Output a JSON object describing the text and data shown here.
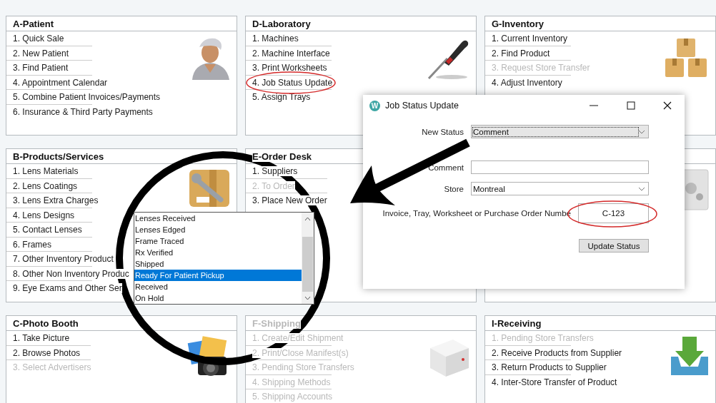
{
  "panels": [
    {
      "title": "A-Patient",
      "disabled": false,
      "items": [
        {
          "label": "1. Quick Sale",
          "disabled": false
        },
        {
          "label": "2. New Patient",
          "disabled": false
        },
        {
          "label": "3. Find Patient",
          "disabled": false
        },
        {
          "label": "4. Appointment Calendar",
          "disabled": false
        },
        {
          "label": "5. Combine Patient Invoices/Payments",
          "disabled": false
        },
        {
          "label": "6. Insurance & Third Party Payments",
          "disabled": false
        }
      ]
    },
    {
      "title": "D-Laboratory",
      "disabled": false,
      "items": [
        {
          "label": "1. Machines",
          "disabled": false
        },
        {
          "label": "2. Machine Interface",
          "disabled": false
        },
        {
          "label": "3. Print Worksheets",
          "disabled": false
        },
        {
          "label": "4. Job Status Update",
          "disabled": false
        },
        {
          "label": "5. Assign Trays",
          "disabled": false
        }
      ]
    },
    {
      "title": "G-Inventory",
      "disabled": false,
      "items": [
        {
          "label": "1. Current Inventory",
          "disabled": false
        },
        {
          "label": "2. Find Product",
          "disabled": false
        },
        {
          "label": "3. Request Store Transfer",
          "disabled": true
        },
        {
          "label": "4. Adjust Inventory",
          "disabled": false
        }
      ]
    },
    {
      "title": "B-Products/Services",
      "disabled": false,
      "items": [
        {
          "label": "1. Lens Materials",
          "disabled": false
        },
        {
          "label": "2. Lens Coatings",
          "disabled": false
        },
        {
          "label": "3. Lens Extra Charges",
          "disabled": false
        },
        {
          "label": "4. Lens Designs",
          "disabled": false
        },
        {
          "label": "5. Contact Lenses",
          "disabled": false
        },
        {
          "label": "6. Frames",
          "disabled": false
        },
        {
          "label": "7. Other Inventory Product",
          "disabled": false
        },
        {
          "label": "8. Other Non Inventory Produc",
          "disabled": false
        },
        {
          "label": "9. Eye Exams and Other Ser",
          "disabled": false
        }
      ]
    },
    {
      "title": "E-Order Desk",
      "disabled": false,
      "items": [
        {
          "label": "1. Suppliers",
          "disabled": false
        },
        {
          "label": "2. To Order",
          "disabled": true
        },
        {
          "label": "3. Place New Order",
          "disabled": false
        }
      ]
    },
    {
      "title": "C-Photo Booth",
      "disabled": false,
      "items": [
        {
          "label": "1. Take Picture",
          "disabled": false
        },
        {
          "label": "2. Browse Photos",
          "disabled": false
        },
        {
          "label": "3. Select Advertisers",
          "disabled": true
        }
      ]
    },
    {
      "title": "F-Shipping",
      "disabled": true,
      "items": [
        {
          "label": "1. Create/Edit Shipment",
          "disabled": true
        },
        {
          "label": "2. Print/Close Manifest(s)",
          "disabled": true
        },
        {
          "label": "3. Pending Store Transfers",
          "disabled": true
        },
        {
          "label": "4. Shipping Methods",
          "disabled": true
        },
        {
          "label": "5. Shipping Accounts",
          "disabled": true
        }
      ]
    },
    {
      "title": "I-Receiving",
      "disabled": false,
      "items": [
        {
          "label": "1. Pending Store Transfers",
          "disabled": true
        },
        {
          "label": "2. Receive Products from Supplier",
          "disabled": false
        },
        {
          "label": "3. Return Products to Supplier",
          "disabled": false
        },
        {
          "label": "4. Inter-Store Transfer of Product",
          "disabled": false
        }
      ]
    }
  ],
  "dropdown": {
    "options": [
      {
        "label": "Lenses Received",
        "selected": false
      },
      {
        "label": "Lenses Edged",
        "selected": false
      },
      {
        "label": "Frame Traced",
        "selected": false
      },
      {
        "label": "Rx Verified",
        "selected": false
      },
      {
        "label": "Shipped",
        "selected": false
      },
      {
        "label": "Ready For Patient Pickup",
        "selected": true
      },
      {
        "label": "Received",
        "selected": false
      },
      {
        "label": "On Hold",
        "selected": false
      }
    ]
  },
  "dialog": {
    "logo": "W",
    "title": "Job Status Update",
    "fields": [
      {
        "kind": "select",
        "label": "New Status",
        "value": "Comment",
        "focused": true
      },
      {
        "kind": "text",
        "label": "Comment",
        "focused": false
      },
      {
        "kind": "select",
        "label": "Store",
        "value": "Montreal",
        "focused": false
      },
      {
        "kind": "text",
        "label": "Invoice, Tray, Worksheet or Purchase Order Numbe",
        "value": "C-123",
        "focused": false
      }
    ],
    "button": "Update Status"
  }
}
